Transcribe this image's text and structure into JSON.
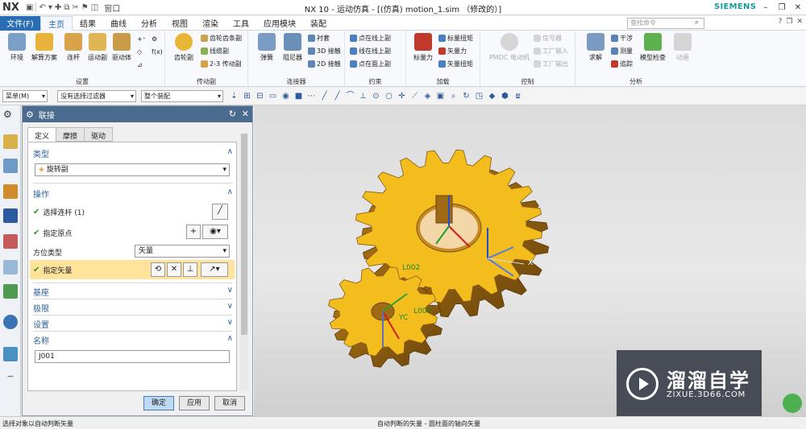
{
  "titlebar": {
    "logo": "NX",
    "window_menu": "窗口",
    "title": "NX 10 - 运动仿真 - [(仿真) motion_1.sim （修改的）]",
    "brand": "SIEMENS"
  },
  "menubar": {
    "file": "文件(F)",
    "tabs": [
      "主页",
      "结果",
      "曲线",
      "分析",
      "视图",
      "渲染",
      "工具",
      "应用模块",
      "装配"
    ],
    "search_placeholder": "查找命令"
  },
  "ribbon": {
    "groups": {
      "setup": {
        "label": "设置",
        "buttons": [
          "环境",
          "解算方案",
          "连杆",
          "运动副",
          "驱动体"
        ]
      },
      "transmission": {
        "label": "传动副",
        "big": "齿轮副",
        "small": [
          "齿轮齿条副",
          "线缆副",
          "2-3 传动副"
        ]
      },
      "connector": {
        "label": "连接器",
        "big": [
          "弹簧",
          "阻尼器"
        ],
        "small": [
          "衬套",
          "3D 接触",
          "2D 接触"
        ]
      },
      "constraint": {
        "label": "约束",
        "small": [
          "点在线上副",
          "线在线上副",
          "点在面上副"
        ]
      },
      "load": {
        "label": "加载",
        "big": "标量力",
        "small": [
          "标量扭矩",
          "矢量力",
          "矢量扭矩"
        ]
      },
      "control": {
        "label": "控制",
        "big": "PMDC 电动机",
        "small": [
          "信号器",
          "工厂输入",
          "工厂输出"
        ]
      },
      "analysis": {
        "label": "分析",
        "big": [
          "求解",
          "模型检查",
          "动画"
        ],
        "small": [
          "干涉",
          "测量",
          "追踪"
        ]
      }
    }
  },
  "selection_bar": {
    "menu": "菜单(M)",
    "filter": "没有选择过滤器",
    "scope": "整个装配"
  },
  "dialog": {
    "title": "联接",
    "tabs": [
      "定义",
      "摩擦",
      "驱动"
    ],
    "sections": {
      "type": "类型",
      "type_value": "旋转副",
      "operation": "操作",
      "select_link": "选择连杆 (1)",
      "specify_origin": "指定原点",
      "orientation_type": "方位类型",
      "orientation_value": "矢量",
      "specify_vector": "指定矢量",
      "base": "基座",
      "limits": "极限",
      "settings": "设置",
      "name": "名称",
      "name_value": "J001"
    },
    "buttons": {
      "ok": "确定",
      "apply": "应用",
      "cancel": "取消"
    }
  },
  "viewport": {
    "labels": {
      "l002": "L002",
      "l001": "L001",
      "yc": "YC",
      "x": "X"
    },
    "gear_color": "#f2bd1d",
    "gear_dark": "#a26b12"
  },
  "status": {
    "left": "选择对象以自动判断矢量",
    "mid": "自动判断的矢量 - 圆柱面的轴向矢量"
  },
  "watermark": {
    "title": "溜溜自学",
    "url": "ZIXUE.3D66.COM"
  }
}
